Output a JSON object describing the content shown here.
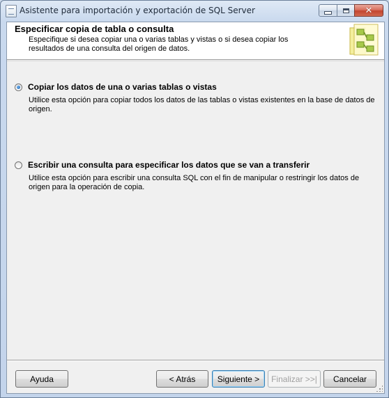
{
  "window": {
    "title": "Asistente para importación y exportación de SQL Server",
    "close_glyph": "✕"
  },
  "header": {
    "title": "Especificar copia de tabla o consulta",
    "description": "Especifique si desea copiar una o varias tablas y vistas o si desea copiar los resultados de una consulta del origen de datos.",
    "icon": "wizard-header-icon"
  },
  "options": [
    {
      "label": "Copiar los datos de una o varias tablas o vistas",
      "description": "Utilice esta opción para copiar todos los datos de las tablas o vistas existentes en la base de datos de origen.",
      "selected": true
    },
    {
      "label": "Escribir una consulta para especificar los datos que se van a transferir",
      "description": "Utilice esta opción para escribir una consulta SQL con el fin de manipular o restringir los datos de origen para la operación de copia.",
      "selected": false
    }
  ],
  "buttons": {
    "help": "Ayuda",
    "back": "< Atrás",
    "next": "Siguiente >",
    "finish": "Finalizar >>|",
    "cancel": "Cancelar"
  },
  "colors": {
    "title_bar": "#c9d9ee",
    "close_button": "#c2452f",
    "header_bg": "#ffffff",
    "dialog_bg": "#f0f0f0"
  }
}
